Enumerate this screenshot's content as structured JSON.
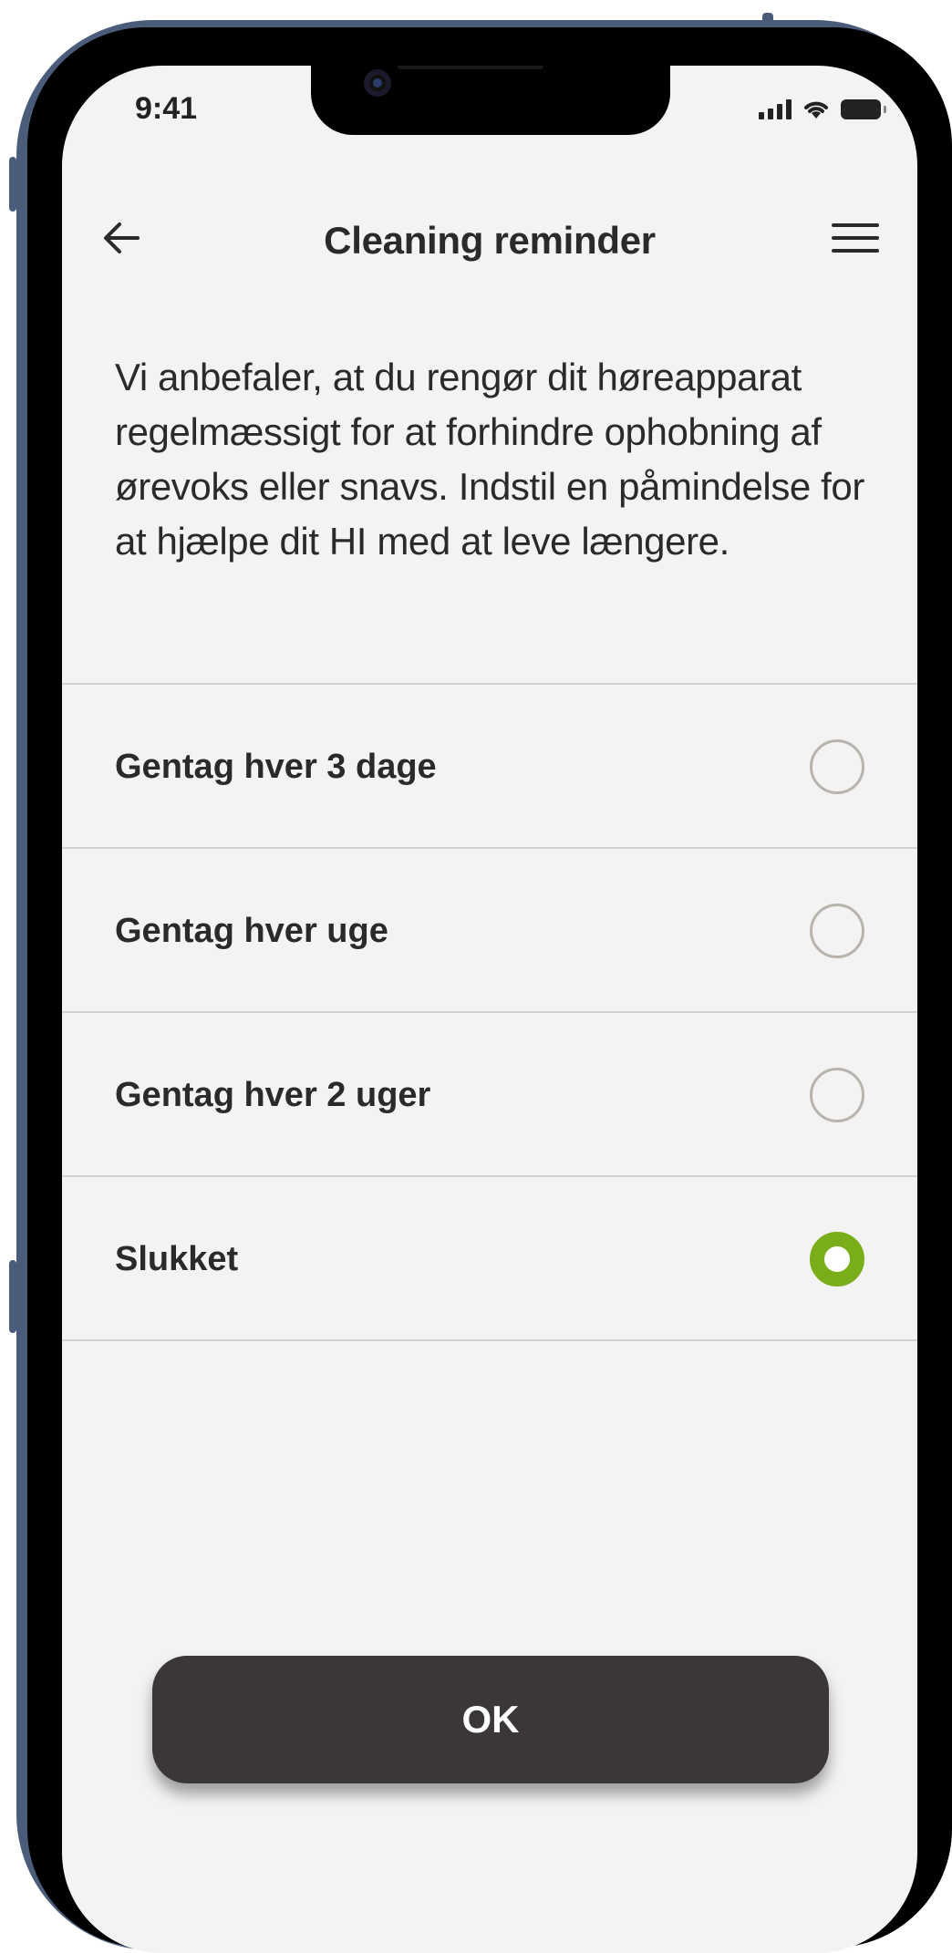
{
  "status_bar": {
    "time": "9:41",
    "signal_icon": "cellular-signal-icon",
    "wifi_icon": "wifi-icon",
    "battery_icon": "battery-icon"
  },
  "header": {
    "title": "Cleaning reminder",
    "back_icon": "arrow-left-icon",
    "menu_icon": "hamburger-menu-icon"
  },
  "description": "Vi anbefaler, at du rengør dit høreapparat regelmæssigt for at forhindre ophobning af ørevoks eller snavs. Indstil en påmindelse for at hjælpe dit HI med at leve længere.",
  "options": [
    {
      "label": "Gentag hver 3 dage",
      "selected": false
    },
    {
      "label": "Gentag hver uge",
      "selected": false
    },
    {
      "label": "Gentag hver 2 uger",
      "selected": false
    },
    {
      "label": "Slukket",
      "selected": true
    }
  ],
  "ok_button": {
    "label": "OK"
  },
  "colors": {
    "accent": "#7aad1a",
    "button_bg": "#3b3637",
    "screen_bg": "#f3f3f3",
    "text": "#2a2a2a",
    "frame": "#4a5c7a"
  }
}
